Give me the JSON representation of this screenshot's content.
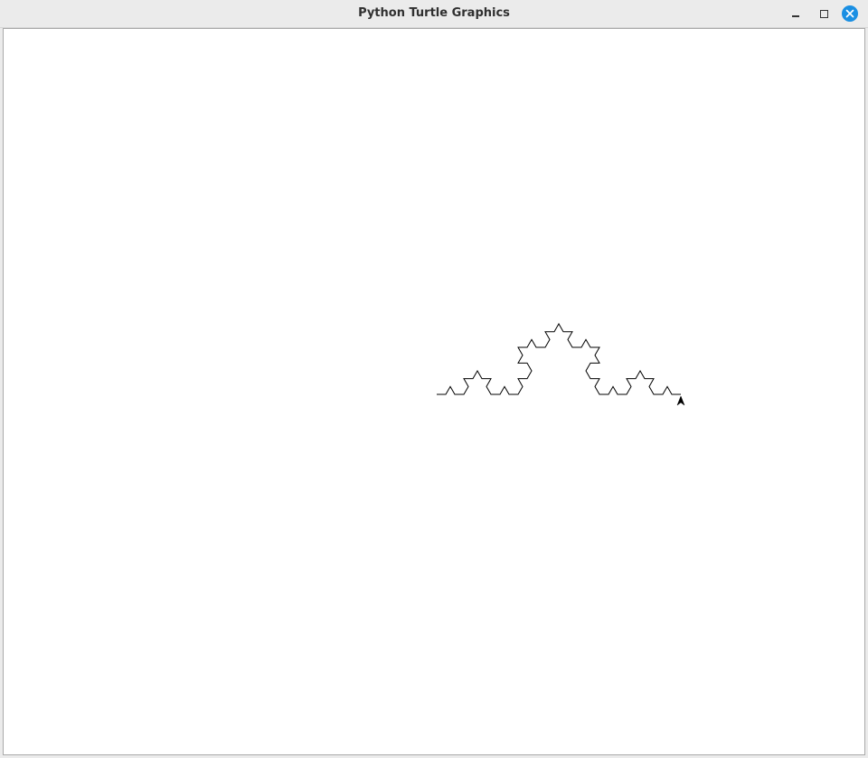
{
  "window": {
    "title": "Python Turtle Graphics",
    "controls": {
      "minimize_icon": "minimize-icon",
      "maximize_icon": "maximize-icon",
      "close_icon": "close-icon",
      "close_color": "#1a8fe3"
    }
  },
  "canvas": {
    "background": "#ffffff",
    "drawing": {
      "shape": "koch-curve",
      "order": 3,
      "pen_color": "#000000"
    },
    "turtle": {
      "icon": "turtle-arrow-icon",
      "heading": "east",
      "color": "#000000"
    }
  }
}
